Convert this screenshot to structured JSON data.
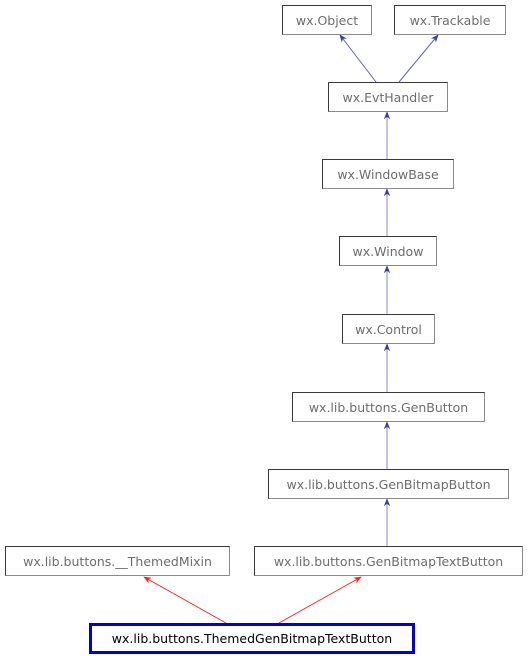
{
  "diagram": {
    "type": "inheritance-diagram",
    "colors": {
      "base_edge": "#3c3ca0",
      "direct_edge": "#ff2020",
      "target_border": "#0000dd"
    },
    "nodes": [
      {
        "id": "wxObject",
        "label": "wx.Object"
      },
      {
        "id": "wxTrackable",
        "label": "wx.Trackable"
      },
      {
        "id": "wxEvtHandler",
        "label": "wx.EvtHandler"
      },
      {
        "id": "wxWindowBase",
        "label": "wx.WindowBase"
      },
      {
        "id": "wxWindow",
        "label": "wx.Window"
      },
      {
        "id": "wxControl",
        "label": "wx.Control"
      },
      {
        "id": "GenButton",
        "label": "wx.lib.buttons.GenButton"
      },
      {
        "id": "GenBitmapButton",
        "label": "wx.lib.buttons.GenBitmapButton"
      },
      {
        "id": "ThemedMixin",
        "label": "wx.lib.buttons.__ThemedMixin"
      },
      {
        "id": "GenBitmapTextButton",
        "label": "wx.lib.buttons.GenBitmapTextButton"
      },
      {
        "id": "ThemedGenBitmapTextButton",
        "label": "wx.lib.buttons.ThemedGenBitmapTextButton",
        "highlighted": true
      }
    ],
    "edges": [
      {
        "from": "wxEvtHandler",
        "to": "wxObject",
        "kind": "base"
      },
      {
        "from": "wxEvtHandler",
        "to": "wxTrackable",
        "kind": "base"
      },
      {
        "from": "wxWindowBase",
        "to": "wxEvtHandler",
        "kind": "base"
      },
      {
        "from": "wxWindow",
        "to": "wxWindowBase",
        "kind": "base"
      },
      {
        "from": "wxControl",
        "to": "wxWindow",
        "kind": "base"
      },
      {
        "from": "GenButton",
        "to": "wxControl",
        "kind": "base"
      },
      {
        "from": "GenBitmapButton",
        "to": "GenButton",
        "kind": "base"
      },
      {
        "from": "GenBitmapTextButton",
        "to": "GenBitmapButton",
        "kind": "base"
      },
      {
        "from": "ThemedGenBitmapTextButton",
        "to": "ThemedMixin",
        "kind": "direct"
      },
      {
        "from": "ThemedGenBitmapTextButton",
        "to": "GenBitmapTextButton",
        "kind": "direct"
      }
    ]
  }
}
